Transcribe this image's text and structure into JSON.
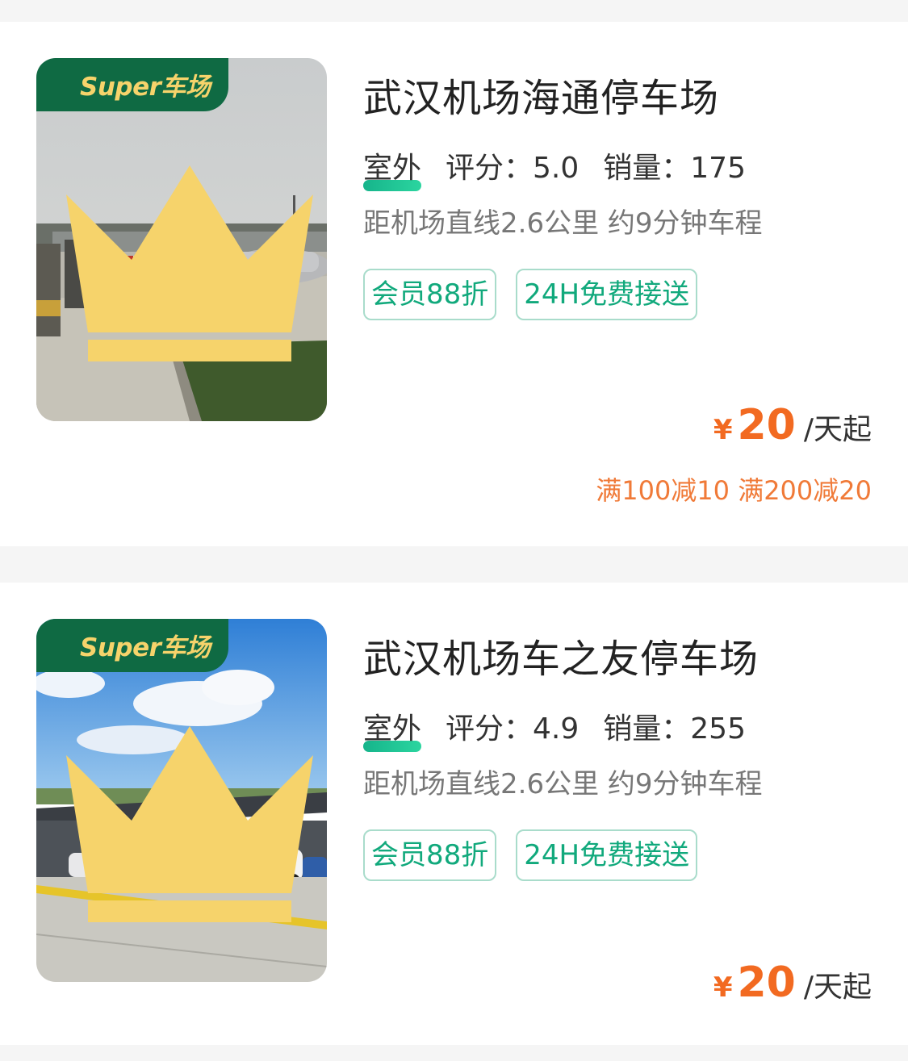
{
  "colors": {
    "badge_green": "#0f6a43",
    "badge_text": "#f6d36b",
    "tag_green": "#11a97c",
    "price_orange": "#f26a21",
    "promo_orange": "#f07a38"
  },
  "lots": [
    {
      "badge": "Super车场",
      "badge_icon": "crown-icon",
      "title": "武汉机场海通停车场",
      "type": "室外",
      "rating": "评分：5.0",
      "sales": "销量：175",
      "distance": "距机场直线2.6公里 约9分钟车程",
      "tags": [
        "会员88折",
        "24H免费接送"
      ],
      "currency": "¥",
      "price": "20",
      "price_unit": "/天起",
      "promo": "满100减10 满200减20"
    },
    {
      "badge": "Super车场",
      "badge_icon": "crown-icon",
      "title": "武汉机场车之友停车场",
      "type": "室外",
      "rating": "评分：4.9",
      "sales": "销量：255",
      "distance": "距机场直线2.6公里 约9分钟车程",
      "tags": [
        "会员88折",
        "24H免费接送"
      ],
      "currency": "¥",
      "price": "20",
      "price_unit": "/天起"
    }
  ]
}
